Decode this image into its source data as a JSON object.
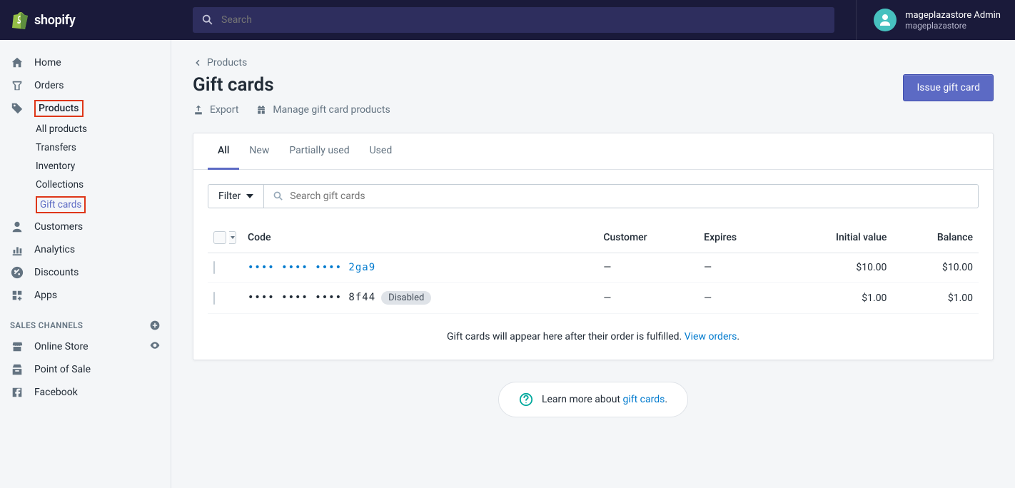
{
  "header": {
    "search_placeholder": "Search",
    "user_name": "mageplazastore Admin",
    "store_name": "mageplazastore"
  },
  "sidebar": {
    "items": [
      {
        "label": "Home"
      },
      {
        "label": "Orders"
      },
      {
        "label": "Products"
      },
      {
        "label": "Customers"
      },
      {
        "label": "Analytics"
      },
      {
        "label": "Discounts"
      },
      {
        "label": "Apps"
      }
    ],
    "products_sub": [
      {
        "label": "All products"
      },
      {
        "label": "Transfers"
      },
      {
        "label": "Inventory"
      },
      {
        "label": "Collections"
      },
      {
        "label": "Gift cards"
      }
    ],
    "section_title": "SALES CHANNELS",
    "channels": [
      {
        "label": "Online Store"
      },
      {
        "label": "Point of Sale"
      },
      {
        "label": "Facebook"
      }
    ]
  },
  "page": {
    "breadcrumb": "Products",
    "title": "Gift cards",
    "actions": {
      "export": "Export",
      "manage": "Manage gift card products"
    },
    "primary_button": "Issue gift card"
  },
  "tabs": [
    "All",
    "New",
    "Partially used",
    "Used"
  ],
  "filter_label": "Filter",
  "search_placeholder": "Search gift cards",
  "table": {
    "headers": {
      "code": "Code",
      "customer": "Customer",
      "expires": "Expires",
      "initial": "Initial value",
      "balance": "Balance"
    },
    "rows": [
      {
        "code": "•••• •••• •••• 2ga9",
        "disabled": false,
        "customer": "—",
        "expires": "—",
        "initial": "$10.00",
        "balance": "$10.00"
      },
      {
        "code": "•••• •••• •••• 8f44",
        "disabled": true,
        "badge": "Disabled",
        "customer": "—",
        "expires": "—",
        "initial": "$1.00",
        "balance": "$1.00"
      }
    ]
  },
  "footer_note": {
    "text": "Gift cards will appear here after their order is fulfilled. ",
    "link": "View orders"
  },
  "learn_more": {
    "text": "Learn more about ",
    "link": "gift cards"
  }
}
